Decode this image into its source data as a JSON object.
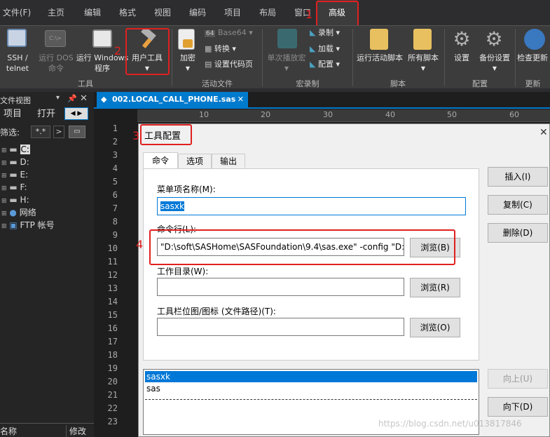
{
  "menu": [
    "文件(F)",
    "主页",
    "编辑",
    "格式",
    "视图",
    "编码",
    "项目",
    "布局",
    "窗口",
    "高级"
  ],
  "ribbon": {
    "ssh": "SSH /",
    "telnet": "telnet",
    "dos1": "运行 DOS",
    "dos2": "命令",
    "win1": "运行 Windows",
    "win2": "程序",
    "user_tools": "用户工具",
    "encrypt": "加密",
    "base64": "Base64",
    "convert": "转换",
    "set_code_page": "设置代码页",
    "record": "录制",
    "load": "加载",
    "config": "配置",
    "single_play": "单次播放宏",
    "run_script": "运行活动脚本",
    "all_scripts": "所有脚本",
    "settings": "设置",
    "backup_settings": "备份设置",
    "check_update": "检查更新",
    "groups": [
      "工具",
      "活动文件",
      "宏录制",
      "脚本",
      "配置",
      "更新"
    ]
  },
  "leftpanel": {
    "title": "文件视图",
    "tab_project": "项目",
    "tab_open": "打开",
    "filter_label": "筛选:",
    "filter_value": "*.*",
    "drives": [
      "C:",
      "D:",
      "E:",
      "F:",
      "H:",
      "网络",
      "FTP 帐号"
    ],
    "col_name": "名称",
    "col_modified": "修改"
  },
  "editor": {
    "tab_title": "002.LOCAL_CALL_PHONE.sas",
    "ruler": [
      "10",
      "20",
      "30",
      "40",
      "50",
      "60"
    ],
    "line_numbers": [
      "1",
      "2",
      "3",
      "4",
      "5",
      "6",
      "7",
      "8",
      "9",
      "10",
      "11",
      "12",
      "13",
      "14",
      "15",
      "16",
      "17",
      "18",
      "19",
      "20",
      "21",
      "22",
      "23"
    ]
  },
  "dialog": {
    "title": "工具配置",
    "tabs": [
      "命令",
      "选项",
      "输出"
    ],
    "menu_name_label": "菜单项名称(M):",
    "menu_name_value": "sasxk",
    "cmd_label": "命令行(L):",
    "cmd_value": "\"D:\\soft\\SASHome\\SASFoundation\\9.4\\sas.exe\" -config \"D:\\",
    "browse_b": "浏览(B)",
    "workdir_label": "工作目录(W):",
    "browse_r": "浏览(R)",
    "toolbar_icon_label": "工具栏位图/图标 (文件路径)(T):",
    "browse_o": "浏览(O)",
    "insert": "插入(I)",
    "copy": "复制(C)",
    "delete": "删除(D)",
    "up": "向上(U)",
    "down": "向下(D)",
    "list": [
      "sasxk",
      "sas"
    ]
  },
  "annotations": [
    "1",
    "2",
    "3",
    "4"
  ],
  "watermark": "https://blog.csdn.net/u013817846",
  "colors": {
    "accent": "#007acc",
    "annotation": "#e02020",
    "selection": "#0078d7"
  }
}
